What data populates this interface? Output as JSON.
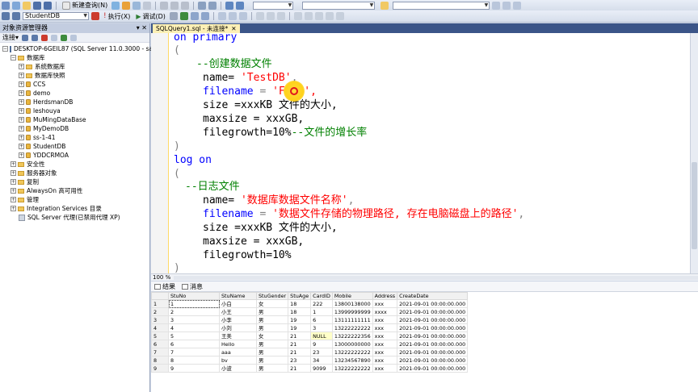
{
  "toolbar1": {
    "new_query": "新建查询(N)",
    "combo2_value": ""
  },
  "toolbar2": {
    "database": "StudentDB",
    "execute": "执行(X)",
    "debug": "调试(D)"
  },
  "object_explorer": {
    "title": "对象资源管理器",
    "pin": "▾ ✕",
    "connect": "连接▾",
    "server": "DESKTOP-6GEIL87 (SQL Server 11.0.3000 - sa)",
    "databases_label": "数据库",
    "databases": [
      "系统数据库",
      "数据库快照",
      "CCS",
      "demo",
      "HerdsmanDB",
      "leshouya",
      "MuMingDataBase",
      "MyDemoDB",
      "ss-1-41",
      "StudentDB",
      "YDDCRMOA"
    ],
    "root_items": [
      "安全性",
      "服务器对象",
      "复制",
      "AlwaysOn 高可用性",
      "管理",
      "Integration Services 目录"
    ],
    "agent": "SQL Server 代理(已禁用代理 XP)"
  },
  "tab": {
    "label": "SQLQuery1.sql - 未连接*",
    "close": "✕"
  },
  "editor": {
    "lines": {
      "l1a": "on primary",
      "l2": "(",
      "l3": "--创建数据文件",
      "l4a": "name=",
      "l4b": "'TestDB'",
      "l4c": ",",
      "l5a": "filename",
      "l5b": " = ",
      "l5c": "'F:",
      "l5d": "',",
      "l6a": "size =xxxKB 文件的大小,",
      "l7a": "maxsize = xxxGB,",
      "l8a": "filegrowth=10%",
      "l8b": "--文件的增长率",
      "l9": ")",
      "l10a": "log on",
      "l11": "(",
      "l12": "--日志文件",
      "l13a": "name=",
      "l13b": "'数据库数据文件名称'",
      "l13c": ",",
      "l14a": "filename",
      "l14b": " = ",
      "l14c": "'数据文件存储的物理路径, 存在电脑磁盘上的路径'",
      "l14d": ",",
      "l15a": "size =xxxKB 文件的大小,",
      "l16a": "maxsize = xxxGB,",
      "l17a": "filegrowth=10%",
      "l18": ")"
    }
  },
  "zoom": "100 %",
  "results_tabs": {
    "results": "结果",
    "messages": "消息"
  },
  "grid": {
    "columns": [
      "StuNo",
      "StuName",
      "StuGender",
      "StuAge",
      "CardID",
      "Mobile",
      "Address",
      "CreateDate"
    ],
    "rows": [
      [
        "1",
        "1",
        "小白",
        "女",
        "18",
        "222",
        "13800138000",
        "xxx",
        "2021-09-01 00:00:00.000"
      ],
      [
        "2",
        "2",
        "小王",
        "男",
        "18",
        "1",
        "13999999999",
        "xxxx",
        "2021-09-01 00:00:00.000"
      ],
      [
        "3",
        "3",
        "小李",
        "男",
        "19",
        "6",
        "13111111111",
        "xxx",
        "2021-09-01 00:00:00.000"
      ],
      [
        "4",
        "4",
        "小刘",
        "男",
        "19",
        "3",
        "13222222222",
        "xxx",
        "2021-09-01 00:00:00.000"
      ],
      [
        "5",
        "5",
        "王美",
        "女",
        "21",
        "NULL",
        "13222222356",
        "xxx",
        "2021-09-01 00:00:00.000"
      ],
      [
        "6",
        "6",
        "Hello",
        "男",
        "21",
        "9",
        "13000000000",
        "xxx",
        "2021-09-01 00:00:00.000"
      ],
      [
        "7",
        "7",
        "aaa",
        "男",
        "21",
        "23",
        "13222222222",
        "xxx",
        "2021-09-01 00:00:00.000"
      ],
      [
        "8",
        "8",
        "bv",
        "男",
        "23",
        "34",
        "13234567890",
        "xxx",
        "2021-09-01 00:00:00.000"
      ],
      [
        "9",
        "9",
        "小波",
        "男",
        "21",
        "9099",
        "13222222222",
        "xxx",
        "2021-09-01 00:00:00.000"
      ]
    ]
  },
  "colors": {
    "keyword": "#0000ff",
    "comment": "#008000",
    "string": "#ff0000",
    "tab_active": "#fdf0b5",
    "tabstrip": "#3b5588"
  }
}
